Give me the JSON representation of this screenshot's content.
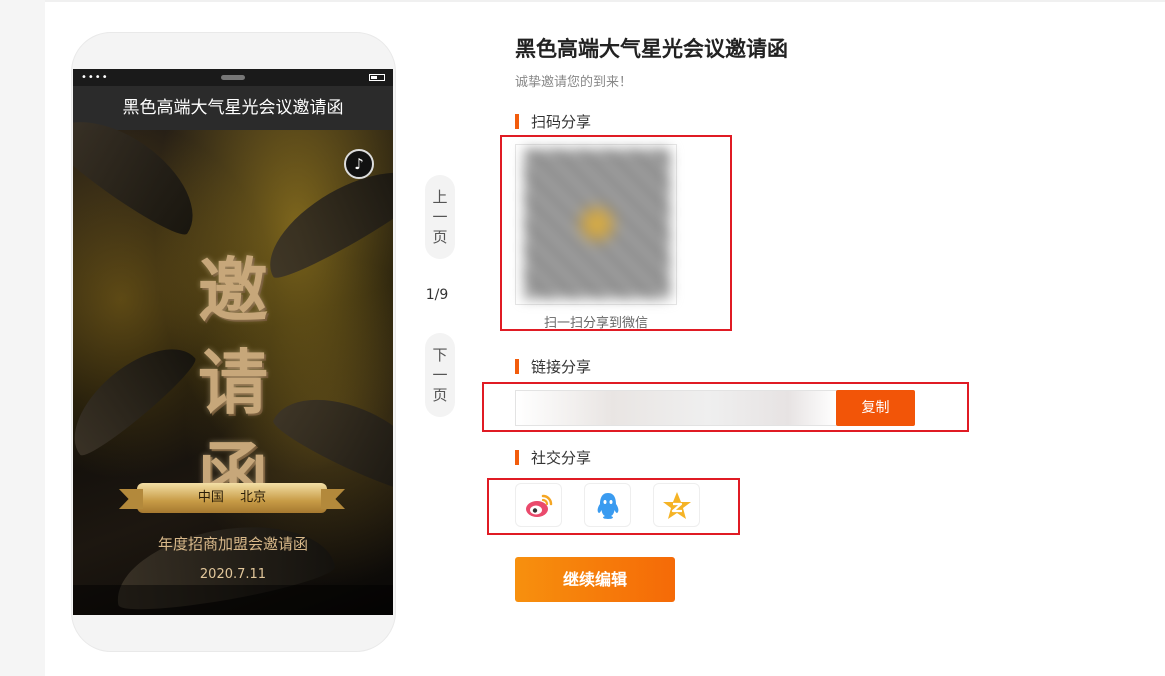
{
  "phone": {
    "title": "黑色高端大气星光会议邀请函",
    "status_dots": "••••",
    "poster": {
      "big_chars": [
        "邀",
        "请",
        "函"
      ],
      "ribbon_left": "中国",
      "ribbon_right": "北京",
      "subtitle": "年度招商加盟会邀请函",
      "date": "2020.7.11"
    }
  },
  "pager": {
    "prev": [
      "上",
      "一",
      "页"
    ],
    "next": [
      "下",
      "一",
      "页"
    ],
    "count": "1/9"
  },
  "panel": {
    "title": "黑色高端大气星光会议邀请函",
    "subtitle": "诚挚邀请您的到来！",
    "qr_section": "扫码分享",
    "qr_caption": "扫一扫分享到微信",
    "link_section": "链接分享",
    "copy_label": "复制",
    "social_section": "社交分享",
    "social_icons": [
      "weibo-icon",
      "qq-icon",
      "qzone-icon"
    ],
    "continue_label": "继续编辑"
  },
  "colors": {
    "accent": "#f25508",
    "highlight_box": "#e01b24"
  }
}
